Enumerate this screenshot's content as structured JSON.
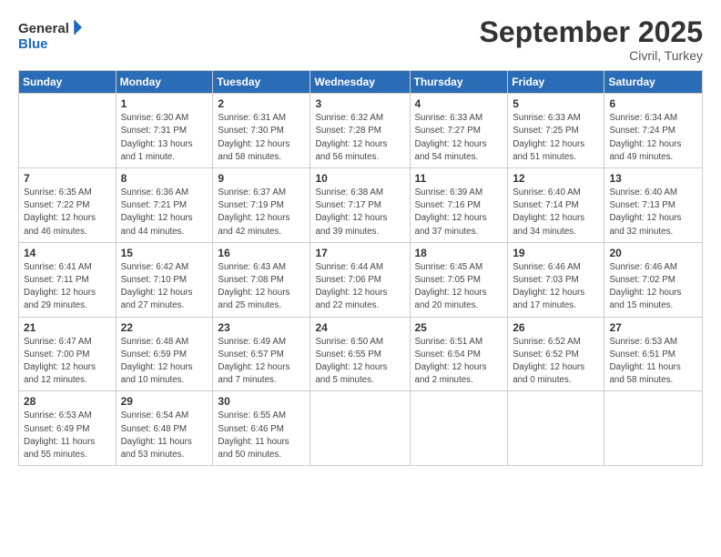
{
  "logo": {
    "line1": "General",
    "line2": "Blue"
  },
  "title": "September 2025",
  "location": "Civril, Turkey",
  "header_days": [
    "Sunday",
    "Monday",
    "Tuesday",
    "Wednesday",
    "Thursday",
    "Friday",
    "Saturday"
  ],
  "weeks": [
    [
      {
        "day": "",
        "info": ""
      },
      {
        "day": "1",
        "info": "Sunrise: 6:30 AM\nSunset: 7:31 PM\nDaylight: 13 hours\nand 1 minute."
      },
      {
        "day": "2",
        "info": "Sunrise: 6:31 AM\nSunset: 7:30 PM\nDaylight: 12 hours\nand 58 minutes."
      },
      {
        "day": "3",
        "info": "Sunrise: 6:32 AM\nSunset: 7:28 PM\nDaylight: 12 hours\nand 56 minutes."
      },
      {
        "day": "4",
        "info": "Sunrise: 6:33 AM\nSunset: 7:27 PM\nDaylight: 12 hours\nand 54 minutes."
      },
      {
        "day": "5",
        "info": "Sunrise: 6:33 AM\nSunset: 7:25 PM\nDaylight: 12 hours\nand 51 minutes."
      },
      {
        "day": "6",
        "info": "Sunrise: 6:34 AM\nSunset: 7:24 PM\nDaylight: 12 hours\nand 49 minutes."
      }
    ],
    [
      {
        "day": "7",
        "info": "Sunrise: 6:35 AM\nSunset: 7:22 PM\nDaylight: 12 hours\nand 46 minutes."
      },
      {
        "day": "8",
        "info": "Sunrise: 6:36 AM\nSunset: 7:21 PM\nDaylight: 12 hours\nand 44 minutes."
      },
      {
        "day": "9",
        "info": "Sunrise: 6:37 AM\nSunset: 7:19 PM\nDaylight: 12 hours\nand 42 minutes."
      },
      {
        "day": "10",
        "info": "Sunrise: 6:38 AM\nSunset: 7:17 PM\nDaylight: 12 hours\nand 39 minutes."
      },
      {
        "day": "11",
        "info": "Sunrise: 6:39 AM\nSunset: 7:16 PM\nDaylight: 12 hours\nand 37 minutes."
      },
      {
        "day": "12",
        "info": "Sunrise: 6:40 AM\nSunset: 7:14 PM\nDaylight: 12 hours\nand 34 minutes."
      },
      {
        "day": "13",
        "info": "Sunrise: 6:40 AM\nSunset: 7:13 PM\nDaylight: 12 hours\nand 32 minutes."
      }
    ],
    [
      {
        "day": "14",
        "info": "Sunrise: 6:41 AM\nSunset: 7:11 PM\nDaylight: 12 hours\nand 29 minutes."
      },
      {
        "day": "15",
        "info": "Sunrise: 6:42 AM\nSunset: 7:10 PM\nDaylight: 12 hours\nand 27 minutes."
      },
      {
        "day": "16",
        "info": "Sunrise: 6:43 AM\nSunset: 7:08 PM\nDaylight: 12 hours\nand 25 minutes."
      },
      {
        "day": "17",
        "info": "Sunrise: 6:44 AM\nSunset: 7:06 PM\nDaylight: 12 hours\nand 22 minutes."
      },
      {
        "day": "18",
        "info": "Sunrise: 6:45 AM\nSunset: 7:05 PM\nDaylight: 12 hours\nand 20 minutes."
      },
      {
        "day": "19",
        "info": "Sunrise: 6:46 AM\nSunset: 7:03 PM\nDaylight: 12 hours\nand 17 minutes."
      },
      {
        "day": "20",
        "info": "Sunrise: 6:46 AM\nSunset: 7:02 PM\nDaylight: 12 hours\nand 15 minutes."
      }
    ],
    [
      {
        "day": "21",
        "info": "Sunrise: 6:47 AM\nSunset: 7:00 PM\nDaylight: 12 hours\nand 12 minutes."
      },
      {
        "day": "22",
        "info": "Sunrise: 6:48 AM\nSunset: 6:59 PM\nDaylight: 12 hours\nand 10 minutes."
      },
      {
        "day": "23",
        "info": "Sunrise: 6:49 AM\nSunset: 6:57 PM\nDaylight: 12 hours\nand 7 minutes."
      },
      {
        "day": "24",
        "info": "Sunrise: 6:50 AM\nSunset: 6:55 PM\nDaylight: 12 hours\nand 5 minutes."
      },
      {
        "day": "25",
        "info": "Sunrise: 6:51 AM\nSunset: 6:54 PM\nDaylight: 12 hours\nand 2 minutes."
      },
      {
        "day": "26",
        "info": "Sunrise: 6:52 AM\nSunset: 6:52 PM\nDaylight: 12 hours\nand 0 minutes."
      },
      {
        "day": "27",
        "info": "Sunrise: 6:53 AM\nSunset: 6:51 PM\nDaylight: 11 hours\nand 58 minutes."
      }
    ],
    [
      {
        "day": "28",
        "info": "Sunrise: 6:53 AM\nSunset: 6:49 PM\nDaylight: 11 hours\nand 55 minutes."
      },
      {
        "day": "29",
        "info": "Sunrise: 6:54 AM\nSunset: 6:48 PM\nDaylight: 11 hours\nand 53 minutes."
      },
      {
        "day": "30",
        "info": "Sunrise: 6:55 AM\nSunset: 6:46 PM\nDaylight: 11 hours\nand 50 minutes."
      },
      {
        "day": "",
        "info": ""
      },
      {
        "day": "",
        "info": ""
      },
      {
        "day": "",
        "info": ""
      },
      {
        "day": "",
        "info": ""
      }
    ]
  ]
}
